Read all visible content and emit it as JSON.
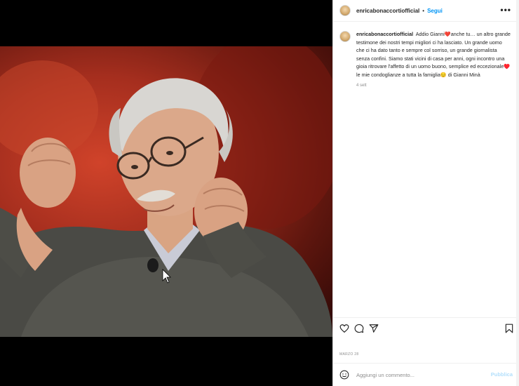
{
  "post": {
    "username": "enricabonaccortiofficial",
    "dot": "•",
    "follow_label": "Segui",
    "more_label": "•••"
  },
  "caption": {
    "username": "enricabonaccortiofficial",
    "text": "Addio Gianni❤️anche tu… un altro grande testimone dei nostri tempi migliori ci ha lasciato. Un grande uomo che ci ha dato tanto e sempre col sorriso, un grande giornalista senza confini. Siamo stati vicini di casa per anni, ogni incontro una gioia ritrovare l'affetto di un uomo buono, semplice ed eccezionale♥️ le mie condoglianze a tutta la famiglia😔 di Gianni Minà",
    "time": "4 sett"
  },
  "actions": {
    "like_icon": "heart-icon",
    "comment_icon": "comment-icon",
    "share_icon": "send-icon",
    "save_icon": "bookmark-icon"
  },
  "date_label": "MARZO 28",
  "comment_box": {
    "emoji_icon": "smiley-icon",
    "placeholder": "Aggiungi un commento...",
    "publish_label": "Pubblica"
  },
  "colors": {
    "accent": "#0095f6",
    "publish_disabled": "#b2dffc",
    "text": "#262626",
    "muted": "#8e8e8e"
  }
}
